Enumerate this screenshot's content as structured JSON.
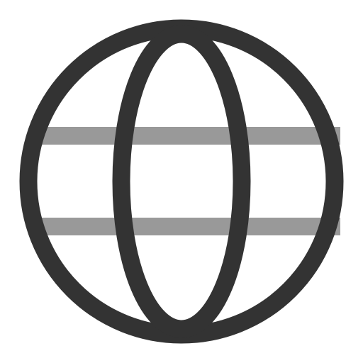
{
  "icon": {
    "name": "globe-icon",
    "colors": {
      "outline": "#333333",
      "latitude_lines": "#999999",
      "background": "#ffffff"
    }
  }
}
